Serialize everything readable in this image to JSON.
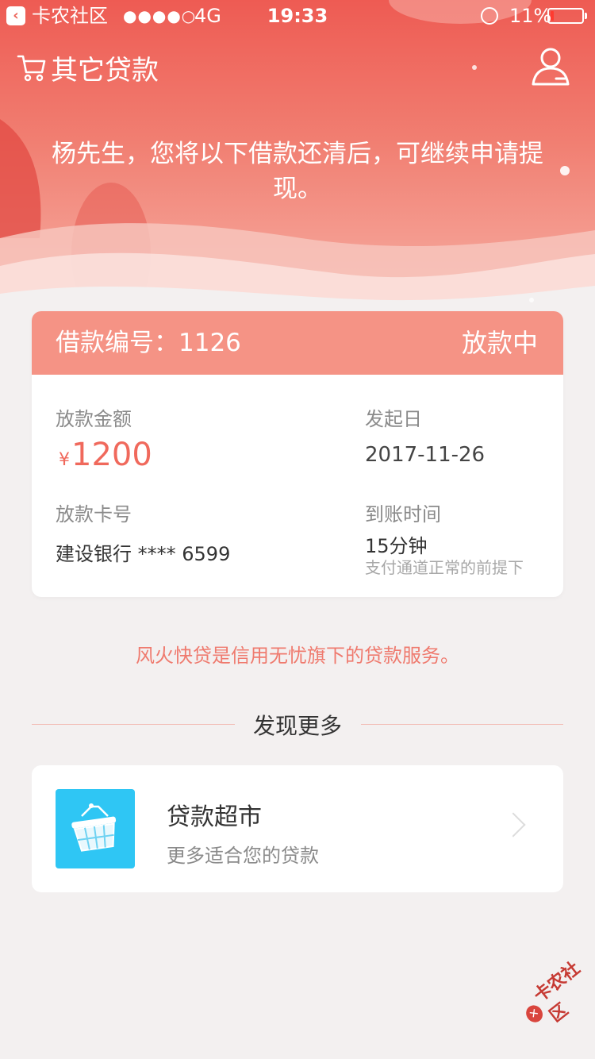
{
  "status_bar": {
    "carrier": "卡农社区",
    "signal": "●●●●○",
    "network": "4G",
    "time": "19:33",
    "battery": "11%",
    "battery_level": 0.11
  },
  "nav": {
    "title": "其它贷款",
    "cart_icon": "cart-icon",
    "user_icon": "user-icon"
  },
  "greeting": "杨先生，您将以下借款还清后，可继续申请提现。",
  "loan": {
    "id_label": "借款编号：1126",
    "status": "放款中",
    "amount_label": "放款金额",
    "currency": "¥",
    "amount": "1200",
    "start_label": "发起日",
    "start_date": "2017-11-26",
    "card_label": "放款卡号",
    "card_value": "建设银行 **** 6599",
    "arrival_label": "到账时间",
    "arrival_value": "15分钟",
    "arrival_note": "支付通道正常的前提下"
  },
  "service_note": "风火快贷是信用无忧旗下的贷款服务。",
  "discover": {
    "title": "发现更多",
    "market": {
      "title": "贷款超市",
      "subtitle": "更多适合您的贷款",
      "icon": "basket-icon"
    }
  },
  "watermark": "卡农社区",
  "colors": {
    "accent": "#f59385",
    "amount": "#f0695c",
    "note": "#ef7a6e",
    "market_icon_bg": "#2fc6f4"
  }
}
